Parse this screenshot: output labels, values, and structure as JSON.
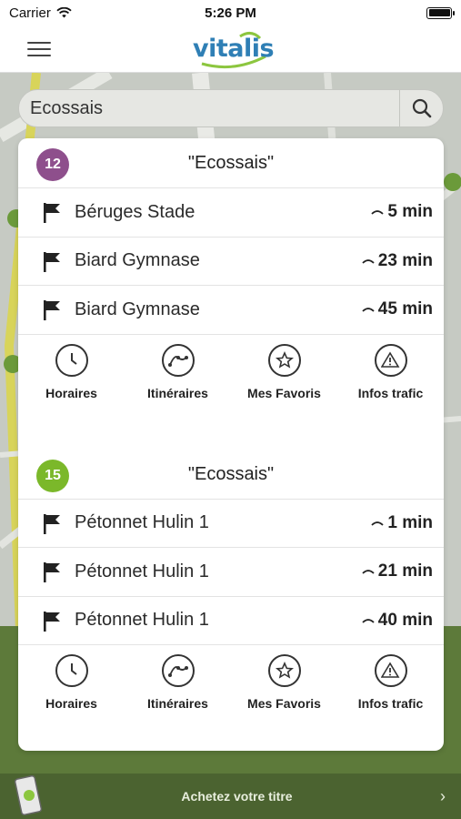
{
  "status": {
    "carrier": "Carrier",
    "time": "5:26 PM"
  },
  "app": {
    "logo": "vitalis"
  },
  "search": {
    "value": "Ecossais"
  },
  "sections": [
    {
      "line": "12",
      "line_color": "#8e4f8c",
      "stop": "\"Ecossais\"",
      "departures": [
        {
          "destination": "Béruges Stade",
          "eta": "5 min"
        },
        {
          "destination": "Biard Gymnase",
          "eta": "23 min"
        },
        {
          "destination": "Biard Gymnase",
          "eta": "45 min"
        }
      ]
    },
    {
      "line": "15",
      "line_color": "#7bb82a",
      "stop": "\"Ecossais\"",
      "departures": [
        {
          "destination": "Pétonnet Hulin 1",
          "eta": "1 min"
        },
        {
          "destination": "Pétonnet Hulin 1",
          "eta": "21 min"
        },
        {
          "destination": "Pétonnet Hulin 1",
          "eta": "40 min"
        }
      ]
    }
  ],
  "actions": {
    "schedule": "Horaires",
    "routes": "Itinéraires",
    "favorites": "Mes Favoris",
    "traffic": "Infos trafic"
  },
  "buy": {
    "label": "Achetez votre titre"
  }
}
